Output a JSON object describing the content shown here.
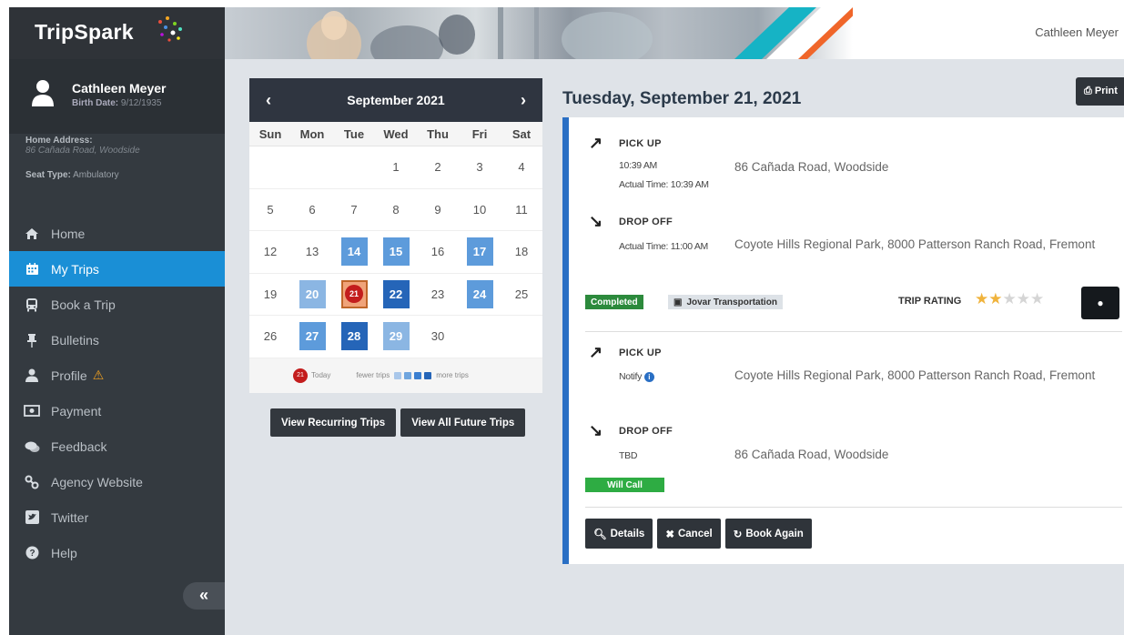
{
  "header": {
    "brand": "TripSpark",
    "user_name": "Cathleen Meyer"
  },
  "profile": {
    "name": "Cathleen Meyer",
    "birth_label": "Birth Date:",
    "birth_value": "9/12/1935",
    "home_label": "Home Address:",
    "home_value": "86 Cañada Road, Woodside",
    "seat_label": "Seat Type:",
    "seat_value": "Ambulatory"
  },
  "nav": {
    "items": [
      {
        "label": "Home",
        "icon": "home-icon"
      },
      {
        "label": "My Trips",
        "icon": "calendar-icon",
        "active": true
      },
      {
        "label": "Book a Trip",
        "icon": "bus-icon"
      },
      {
        "label": "Bulletins",
        "icon": "pushpin-icon"
      },
      {
        "label": "Profile",
        "icon": "user-icon",
        "warning": true
      },
      {
        "label": "Payment",
        "icon": "money-icon"
      },
      {
        "label": "Feedback",
        "icon": "comments-icon"
      },
      {
        "label": "Agency Website",
        "icon": "link-icon"
      },
      {
        "label": "Twitter",
        "icon": "twitter-icon"
      },
      {
        "label": "Help",
        "icon": "question-icon"
      }
    ],
    "collapse_symbol": "«"
  },
  "calendar": {
    "month_title": "September 2021",
    "prev": "‹",
    "next": "›",
    "weekdays": [
      "Sun",
      "Mon",
      "Tue",
      "Wed",
      "Thu",
      "Fri",
      "Sat"
    ],
    "weeks": [
      [
        null,
        null,
        null,
        {
          "d": "1"
        },
        {
          "d": "2"
        },
        {
          "d": "3"
        },
        {
          "d": "4"
        }
      ],
      [
        {
          "d": "5"
        },
        {
          "d": "6"
        },
        {
          "d": "7"
        },
        {
          "d": "8"
        },
        {
          "d": "9"
        },
        {
          "d": "10"
        },
        {
          "d": "11"
        }
      ],
      [
        {
          "d": "12"
        },
        {
          "d": "13"
        },
        {
          "d": "14",
          "lvl": 2
        },
        {
          "d": "15",
          "lvl": 2
        },
        {
          "d": "16"
        },
        {
          "d": "17",
          "lvl": 2
        },
        {
          "d": "18"
        }
      ],
      [
        {
          "d": "19"
        },
        {
          "d": "20",
          "lvl": 1
        },
        {
          "d": "21",
          "today": true
        },
        {
          "d": "22",
          "lvl": 4
        },
        {
          "d": "23"
        },
        {
          "d": "24",
          "lvl": 2
        },
        {
          "d": "25"
        }
      ],
      [
        {
          "d": "26"
        },
        {
          "d": "27",
          "lvl": 2
        },
        {
          "d": "28",
          "lvl": 4
        },
        {
          "d": "29",
          "lvl": 1
        },
        {
          "d": "30"
        },
        null,
        null
      ]
    ],
    "legend_today_num": "21",
    "legend_today": "Today",
    "legend_fewer": "fewer trips",
    "legend_more": "more trips",
    "legend_colors": [
      "#a9c7ea",
      "#6fa5de",
      "#3b7fd0",
      "#2565b8"
    ],
    "btn_recurring": "View Recurring Trips",
    "btn_future": "View All Future Trips"
  },
  "trips": {
    "date_title": "Tuesday, September 21, 2021",
    "print_label": "Print",
    "trip1": {
      "pickup_label": "PICK UP",
      "pickup_time": "10:39 AM",
      "pickup_actual": "Actual Time: 10:39 AM",
      "pickup_addr": "86 Cañada Road, Woodside",
      "dropoff_label": "DROP OFF",
      "dropoff_actual": "Actual Time: 11:00 AM",
      "dropoff_addr": "Coyote Hills Regional Park, 8000 Patterson Ranch Road, Fremont",
      "status": "Completed",
      "provider": "Jovar Transportation",
      "rating_label": "TRIP RATING",
      "rating": 2,
      "rating_max": 5
    },
    "trip2": {
      "pickup_label": "PICK UP",
      "pickup_time": "Notify",
      "pickup_addr": "Coyote Hills Regional Park, 8000 Patterson Ranch Road, Fremont",
      "dropoff_label": "DROP OFF",
      "dropoff_time": "TBD",
      "dropoff_addr": "86 Cañada Road, Woodside",
      "status": "Will Call"
    },
    "actions": {
      "details": "Details",
      "cancel": "Cancel",
      "book_again": "Book Again"
    }
  },
  "colors": {
    "accent": "#1a8fd6",
    "sidebar": "#343a40",
    "trip_border": "#2a6fc4",
    "completed": "#2c8a3c",
    "today": "#c31d1d"
  }
}
